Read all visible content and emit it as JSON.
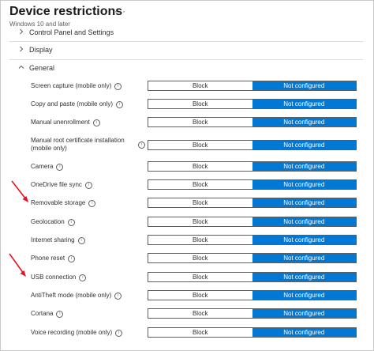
{
  "header": {
    "title": "Device restrictions",
    "more": "···",
    "subtitle": "Windows 10 and later"
  },
  "sections": {
    "control_panel": "Control Panel and Settings",
    "display": "Display",
    "general": "General"
  },
  "toggle": {
    "block_label": "Block",
    "not_configured_label": "Not configured",
    "accent_color": "#0078d4"
  },
  "info_glyph": "i",
  "settings": [
    {
      "label": "Screen capture (mobile only)",
      "value": "Not configured"
    },
    {
      "label": "Copy and paste (mobile only)",
      "value": "Not configured"
    },
    {
      "label": "Manual unenrollment",
      "value": "Not configured"
    },
    {
      "label": "Manual root certificate installation (mobile only)",
      "value": "Not configured"
    },
    {
      "label": "Camera",
      "value": "Not configured"
    },
    {
      "label": "OneDrive file sync",
      "value": "Not configured"
    },
    {
      "label": "Removable storage",
      "value": "Not configured"
    },
    {
      "label": "Geolocation",
      "value": "Not configured"
    },
    {
      "label": "Internet sharing",
      "value": "Not configured"
    },
    {
      "label": "Phone reset",
      "value": "Not configured"
    },
    {
      "label": "USB connection",
      "value": "Not configured"
    },
    {
      "label": "AntiTheft mode (mobile only)",
      "value": "Not configured"
    },
    {
      "label": "Cortana",
      "value": "Not configured"
    },
    {
      "label": "Voice recording (mobile only)",
      "value": "Not configured"
    }
  ],
  "annotations": {
    "arrow_color": "#e81123"
  }
}
